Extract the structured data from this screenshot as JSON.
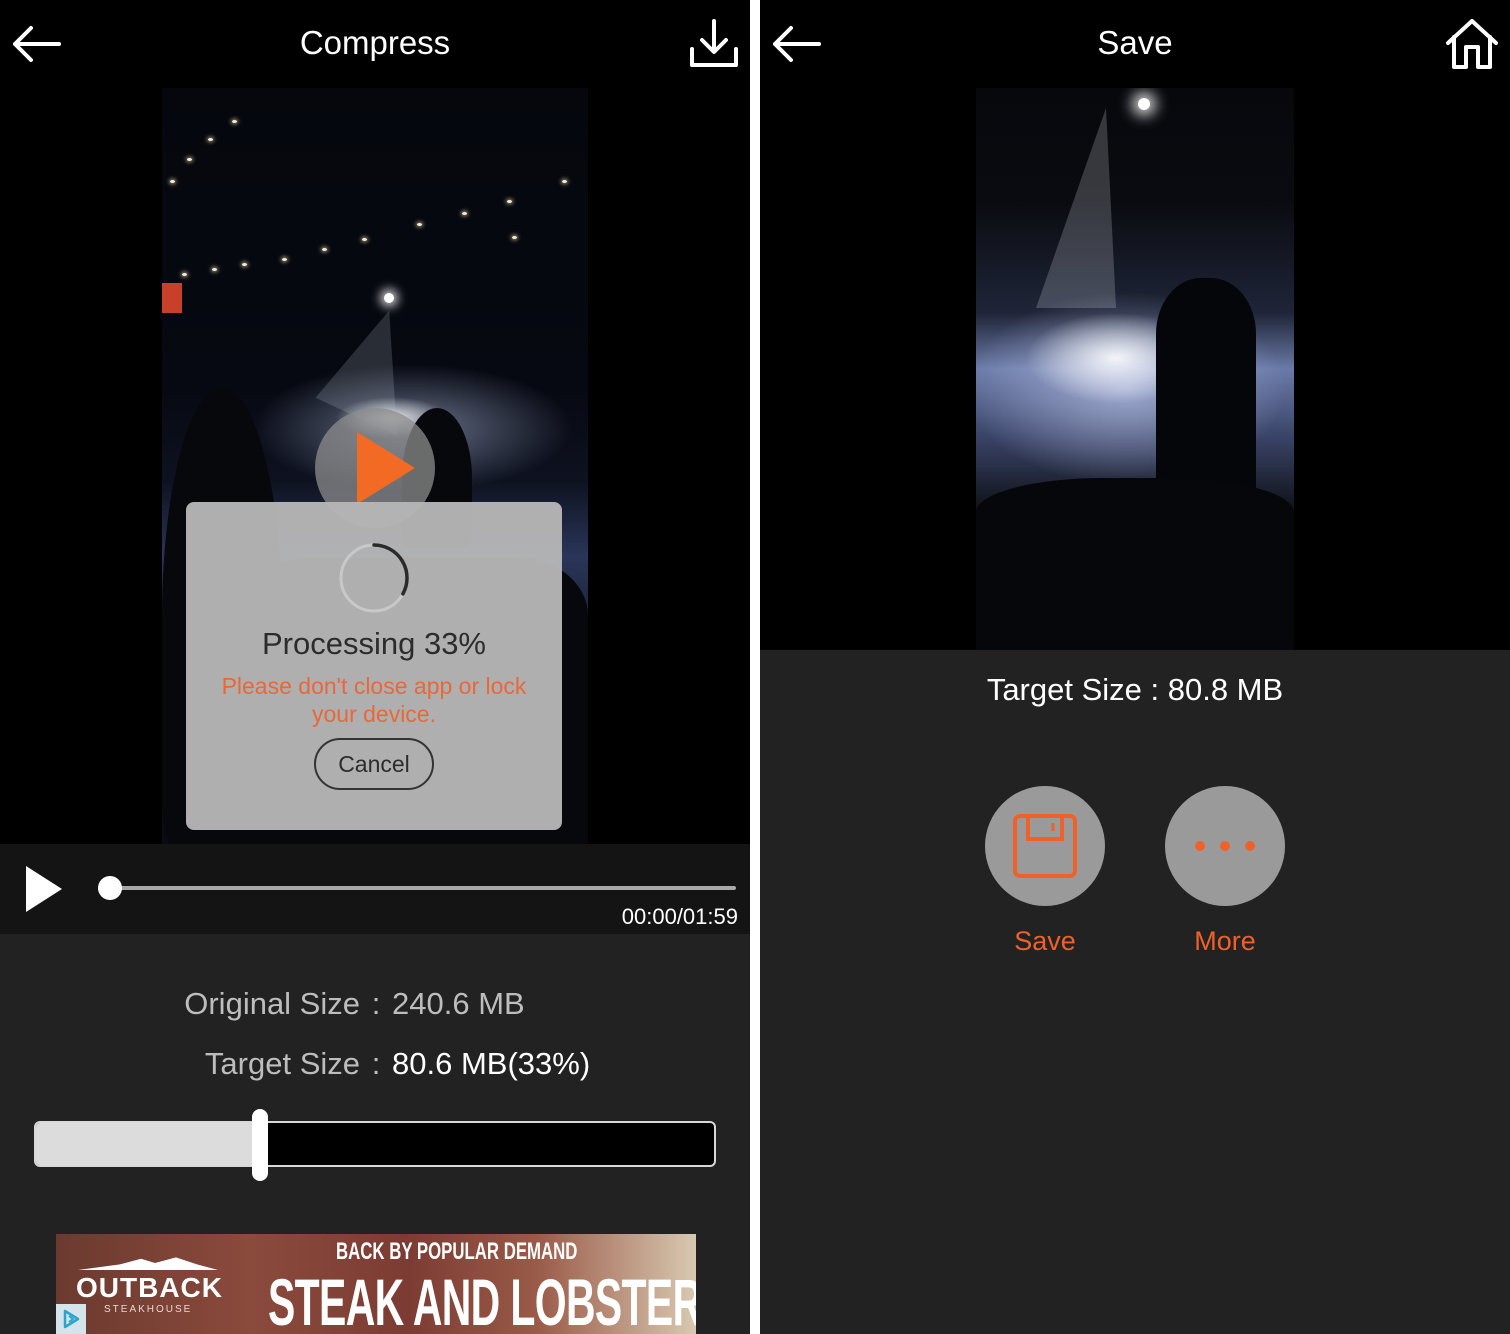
{
  "colors": {
    "accent_orange": "#f0612a",
    "warning_orange": "#e8683a",
    "background_dark": "#222222",
    "navbar_black": "#000000"
  },
  "compress_screen": {
    "header": {
      "back_icon": "arrow-left-icon",
      "title": "Compress",
      "download_icon": "download-icon"
    },
    "video": {
      "play_overlay_icon": "play-icon"
    },
    "processing_dialog": {
      "spinner_icon": "spinner-icon",
      "title": "Processing 33%",
      "progress_percent": 33,
      "warning": "Please don't close app or lock your device.",
      "cancel_label": "Cancel"
    },
    "player_controls": {
      "play_icon": "play-icon",
      "seek_position_fraction": 0.0,
      "time_readout": "00:00/01:59"
    },
    "sizes": {
      "original_label": "Original Size",
      "original_value": "240.6 MB",
      "target_label": "Target Size",
      "target_value": "80.6 MB(33%)",
      "separator": ":"
    },
    "target_slider": {
      "value_percent": 33
    },
    "ad": {
      "brand": "OUTBACK",
      "brand_sub": "STEAKHOUSE",
      "tagline": "BACK BY POPULAR DEMAND",
      "headline": "STEAK AND LOBSTER",
      "adchoices_icon": "adchoices-icon"
    }
  },
  "save_screen": {
    "header": {
      "back_icon": "arrow-left-icon",
      "title": "Save",
      "home_icon": "home-icon"
    },
    "target_size": "Target Size : 80.8 MB",
    "actions": [
      {
        "icon": "floppy-disk-icon",
        "label": "Save"
      },
      {
        "icon": "more-dots-icon",
        "label": "More"
      }
    ]
  }
}
